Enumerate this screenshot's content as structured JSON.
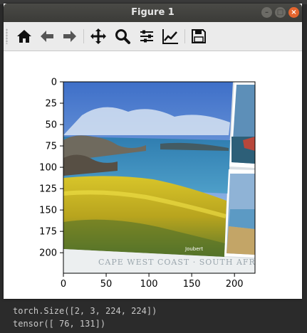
{
  "window": {
    "title": "Figure 1",
    "controls": {
      "minimize": "–",
      "maximize": "□",
      "close": "×"
    }
  },
  "toolbar": {
    "buttons": [
      {
        "name": "home",
        "icon": "home-icon"
      },
      {
        "name": "back",
        "icon": "arrow-left-icon"
      },
      {
        "name": "forward",
        "icon": "arrow-right-icon"
      },
      {
        "name": "pan",
        "icon": "move-icon"
      },
      {
        "name": "zoom",
        "icon": "magnifier-icon"
      },
      {
        "name": "configure-subplots",
        "icon": "sliders-icon"
      },
      {
        "name": "edit-axis",
        "icon": "line-chart-icon"
      },
      {
        "name": "save",
        "icon": "floppy-disk-icon"
      }
    ]
  },
  "plot": {
    "x_ticks": [
      "0",
      "50",
      "100",
      "150",
      "200"
    ],
    "y_ticks": [
      "0",
      "25",
      "50",
      "75",
      "100",
      "125",
      "150",
      "175",
      "200"
    ],
    "xlim": [
      0,
      224
    ],
    "ylim": [
      224,
      0
    ],
    "image_caption": "CAPE WEST COAST · SOUTH AFR",
    "image_signature": "Joubert"
  },
  "terminal": {
    "lines": [
      "torch.Size([2, 3, 224, 224])",
      "tensor([ 76, 131])"
    ]
  },
  "colors": {
    "title_bar": "#3b3b38",
    "close_button": "#e5652e",
    "toolbar_bg": "#ebebeb",
    "terminal_bg": "#2b2b2b"
  }
}
